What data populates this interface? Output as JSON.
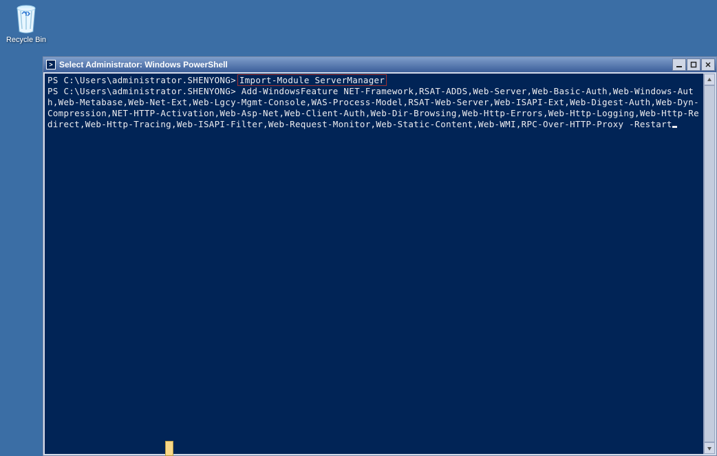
{
  "desktop": {
    "recycle_bin_label": "Recycle Bin"
  },
  "window": {
    "title": "Select Administrator: Windows PowerShell"
  },
  "console": {
    "prompt": "PS C:\\Users\\administrator.SHENYONG>",
    "line1_cmd": "Import-Module ServerManager",
    "line2_cmd": "Add-WindowsFeature NET-Framework,RSAT-ADDS,Web-Server,Web-Basic-Auth,Web-Windows-Auth,Web-Metabase,Web-Net-Ext,Web-Lgcy-Mgmt-Console,WAS-Process-Model,RSAT-Web-Server,Web-ISAPI-Ext,Web-Digest-Auth,Web-Dyn-Compression,NET-HTTP-Activation,Web-Asp-Net,Web-Client-Auth,Web-Dir-Browsing,Web-Http-Errors,Web-Http-Logging,Web-Http-Redirect,Web-Http-Tracing,Web-ISAPI-Filter,Web-Request-Monitor,Web-Static-Content,Web-WMI,RPC-Over-HTTP-Proxy -Restart"
  }
}
